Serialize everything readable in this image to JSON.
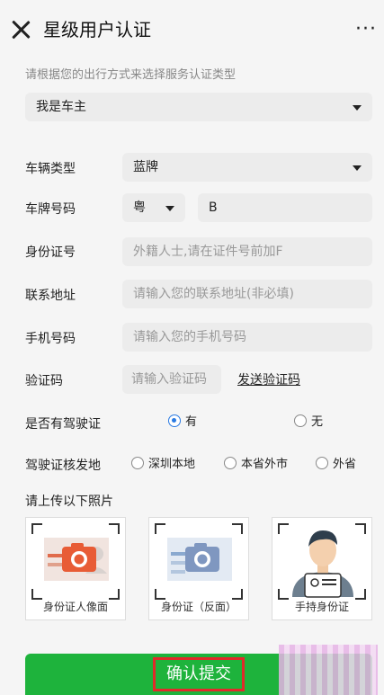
{
  "header": {
    "title": "星级用户认证",
    "more": "···"
  },
  "hint": "请根据您的出行方式来选择服务认证类型",
  "auth_type": {
    "value": "我是车主"
  },
  "vehicle_type": {
    "label": "车辆类型",
    "value": "蓝牌"
  },
  "plate": {
    "label": "车牌号码",
    "province": "粤",
    "value": "B"
  },
  "id_number": {
    "label": "身份证号",
    "placeholder": "外籍人士,请在证件号前加F"
  },
  "address": {
    "label": "联系地址",
    "placeholder": "请输入您的联系地址(非必填)"
  },
  "phone": {
    "label": "手机号码",
    "placeholder": "请输入您的手机号码"
  },
  "code": {
    "label": "验证码",
    "placeholder": "请输入验证码",
    "send_label": "发送验证码"
  },
  "has_license": {
    "label": "是否有驾驶证",
    "options": [
      "有",
      "无"
    ],
    "selected": "有"
  },
  "license_origin": {
    "label": "驾驶证核发地",
    "options": [
      "深圳本地",
      "本省外市",
      "外省"
    ]
  },
  "upload": {
    "label": "请上传以下照片",
    "cards": [
      "身份证人像面",
      "身份证（反面）",
      "手持身份证"
    ]
  },
  "submit": {
    "label": "确认提交"
  },
  "colors": {
    "accent": "#1eb33c",
    "highlight": "#e12a2a",
    "radio": "#2a7ae2"
  }
}
